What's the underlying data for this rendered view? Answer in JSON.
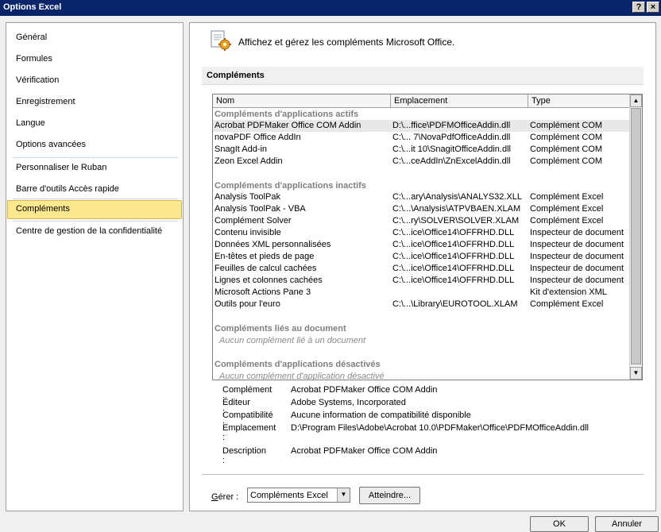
{
  "window": {
    "title": "Options Excel",
    "help_label": "?",
    "close_label": "×"
  },
  "sidebar": {
    "items": [
      {
        "label": "Général"
      },
      {
        "label": "Formules"
      },
      {
        "label": "Vérification"
      },
      {
        "label": "Enregistrement"
      },
      {
        "label": "Langue"
      },
      {
        "label": "Options avancées"
      },
      {
        "label": "Personnaliser le Ruban"
      },
      {
        "label": "Barre d'outils Accès rapide"
      },
      {
        "label": "Compléments",
        "selected": true
      },
      {
        "label": "Centre de gestion de la confidentialité"
      }
    ]
  },
  "main": {
    "header": "Affichez et gérez les compléments Microsoft Office.",
    "section_title": "Compléments",
    "columns": [
      "Nom",
      "Emplacement",
      "Type"
    ],
    "groups": [
      {
        "title": "Compléments d'applications actifs",
        "rows": [
          [
            "Acrobat PDFMaker Office COM Addin",
            "D:\\...ffice\\PDFMOfficeAddin.dll",
            "Complément COM"
          ],
          [
            "novaPDF Office AddIn",
            "C:\\... 7\\NovaPdfOfficeAddin.dll",
            "Complément COM"
          ],
          [
            "SnagIt Add-in",
            "C:\\...it 10\\SnagitOfficeAddin.dll",
            "Complément COM"
          ],
          [
            "Zeon Excel Addin",
            "C:\\...ceAddIn\\ZnExcelAddin.dll",
            "Complément COM"
          ]
        ]
      },
      {
        "title": "Compléments d'applications inactifs",
        "rows": [
          [
            "Analysis ToolPak",
            "C:\\...ary\\Analysis\\ANALYS32.XLL",
            "Complément Excel"
          ],
          [
            "Analysis ToolPak - VBA",
            "C:\\...\\Analysis\\ATPVBAEN.XLAM",
            "Complément Excel"
          ],
          [
            "Complément Solver",
            "C:\\...ry\\SOLVER\\SOLVER.XLAM",
            "Complément Excel"
          ],
          [
            "Contenu invisible",
            "C:\\...ice\\Office14\\OFFRHD.DLL",
            "Inspecteur de document"
          ],
          [
            "Données XML personnalisées",
            "C:\\...ice\\Office14\\OFFRHD.DLL",
            "Inspecteur de document"
          ],
          [
            "En-têtes et pieds de page",
            "C:\\...ice\\Office14\\OFFRHD.DLL",
            "Inspecteur de document"
          ],
          [
            "Feuilles de calcul cachées",
            "C:\\...ice\\Office14\\OFFRHD.DLL",
            "Inspecteur de document"
          ],
          [
            "Lignes et colonnes cachées",
            "C:\\...ice\\Office14\\OFFRHD.DLL",
            "Inspecteur de document"
          ],
          [
            "Microsoft Actions Pane 3",
            "",
            "Kit d'extension XML"
          ],
          [
            "Outils pour l'euro",
            "C:\\...\\Library\\EUROTOOL.XLAM",
            "Complément Excel"
          ]
        ]
      },
      {
        "title": "Compléments liés au document",
        "empty": "Aucun complément lié à un document"
      },
      {
        "title": "Compléments d'applications désactivés",
        "empty": "Aucun complément d'application désactivé"
      }
    ],
    "details": {
      "addin_label": "Complément :",
      "addin_value": "Acrobat PDFMaker Office COM Addin",
      "publisher_label": "Éditeur :",
      "publisher_value": "Adobe Systems, Incorporated",
      "compat_label": "Compatibilité :",
      "compat_value": "Aucune information de compatibilité disponible",
      "location_label": "Emplacement :",
      "location_value": "D:\\Program Files\\Adobe\\Acrobat 10.0\\PDFMaker\\Office\\PDFMOfficeAddin.dll",
      "description_label": "Description :",
      "description_value": "Acrobat PDFMaker Office COM Addin"
    },
    "manage": {
      "label_g": "G",
      "label_rest": "érer :",
      "select_value": "Compléments Excel",
      "go_label": "Atteindre..."
    }
  },
  "footer": {
    "ok_label": "OK",
    "cancel_label": "Annuler"
  },
  "colors": {
    "titlebar": "#0a246a",
    "selected_nav": "#fde890",
    "group_header": "#7f7f7f"
  },
  "icons": {
    "header": "addins-gear-icon"
  }
}
